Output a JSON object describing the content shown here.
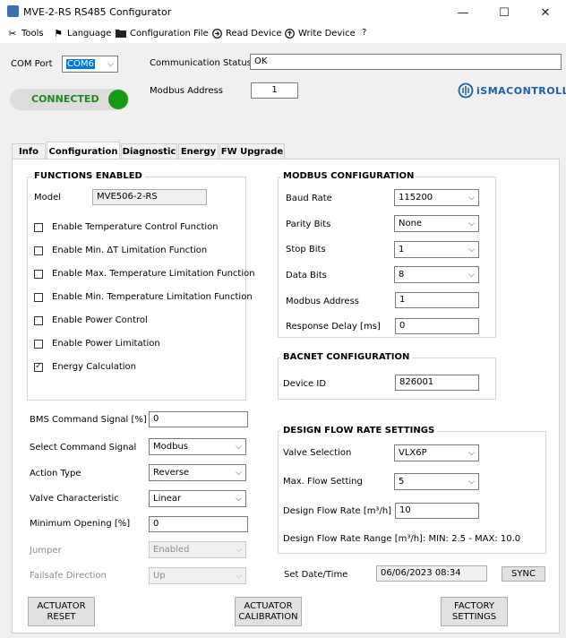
{
  "window": {
    "title": "MVE-2-RS RS485 Configurator",
    "minimize": "—",
    "maximize": "☐",
    "close": "✕"
  },
  "menu": [
    {
      "label": "Tools",
      "icon": "tools-icon",
      "glyph": "✂"
    },
    {
      "label": "Language",
      "icon": "flag-icon",
      "glyph": "⚑"
    },
    {
      "label": "Configuration File",
      "icon": "folder-icon",
      "glyph": "📁"
    },
    {
      "label": "Read Device",
      "icon": "read-icon",
      "glyph": "⊙"
    },
    {
      "label": "Write Device",
      "icon": "write-icon",
      "glyph": "⊙"
    },
    {
      "label": "?",
      "icon": "",
      "glyph": ""
    }
  ],
  "connection": {
    "com_port_label": "COM Port",
    "com_port_value": "COM6",
    "status_label": "Communication Status",
    "status_value": "OK",
    "modbus_address_label": "Modbus Address",
    "modbus_address_value": "1",
    "connected_label": "CONNECTED",
    "connected_color": "#1aa31a"
  },
  "brand": {
    "logo_text": "iSMACONTROLLI",
    "logo_color": "#1a5fa8"
  },
  "tabs": [
    "Info",
    "Configuration",
    "Diagnostic",
    "Energy",
    "FW Upgrade"
  ],
  "active_tab": "Configuration",
  "functions": {
    "title": "FUNCTIONS ENABLED",
    "model_label": "Model",
    "model_value": "MVE506-2-RS",
    "checkboxes": [
      {
        "label": "Enable Temperature Control Function",
        "checked": false
      },
      {
        "label": "Enable Min. ΔT Limitation Function",
        "checked": false
      },
      {
        "label": "Enable Max. Temperature Limitation Function",
        "checked": false
      },
      {
        "label": "Enable Min. Temperature Limitation Function",
        "checked": false
      },
      {
        "label": "Enable Power Control",
        "checked": false
      },
      {
        "label": "Enable Power Limitation",
        "checked": false
      },
      {
        "label": "Energy Calculation",
        "checked": true
      }
    ]
  },
  "settings": {
    "bms_label": "BMS Command Signal [%]",
    "bms_value": "0",
    "select_signal_label": "Select Command Signal",
    "select_signal_value": "Modbus",
    "action_type_label": "Action Type",
    "action_type_value": "Reverse",
    "valve_char_label": "Valve Characteristic",
    "valve_char_value": "Linear",
    "min_opening_label": "Minimum Opening [%]",
    "min_opening_value": "0",
    "jumper_label": "Jumper",
    "jumper_value": "Enabled",
    "failsafe_label": "Failsafe Direction",
    "failsafe_value": "Up"
  },
  "modbus": {
    "title": "MODBUS CONFIGURATION",
    "baud_label": "Baud Rate",
    "baud_value": "115200",
    "parity_label": "Parity Bits",
    "parity_value": "None",
    "stop_label": "Stop Bits",
    "stop_value": "1",
    "data_label": "Data Bits",
    "data_value": "8",
    "address_label": "Modbus Address",
    "address_value": "1",
    "delay_label": "Response Delay [ms]",
    "delay_value": "0"
  },
  "bacnet": {
    "title": "BACNET CONFIGURATION",
    "device_id_label": "Device ID",
    "device_id_value": "826001"
  },
  "design_flow": {
    "title": "DESIGN FLOW RATE SETTINGS",
    "valve_label": "Valve Selection",
    "valve_value": "VLX6P",
    "max_flow_label": "Max. Flow Setting",
    "max_flow_value": "5",
    "rate_label": "Design Flow Rate [m³/h]",
    "rate_value": "10",
    "range_text": "Design Flow Rate Range [m³/h]: MIN: 2.5 - MAX: 10.0"
  },
  "datetime": {
    "label": "Set Date/Time",
    "value": "06/06/2023 08:34",
    "sync_label": "SYNC"
  },
  "buttons": {
    "reset_line1": "ACTUATOR",
    "reset_line2": "RESET",
    "calib_line1": "ACTUATOR",
    "calib_line2": "CALIBRATION",
    "factory_line1": "FACTORY",
    "factory_line2": "SETTINGS"
  }
}
